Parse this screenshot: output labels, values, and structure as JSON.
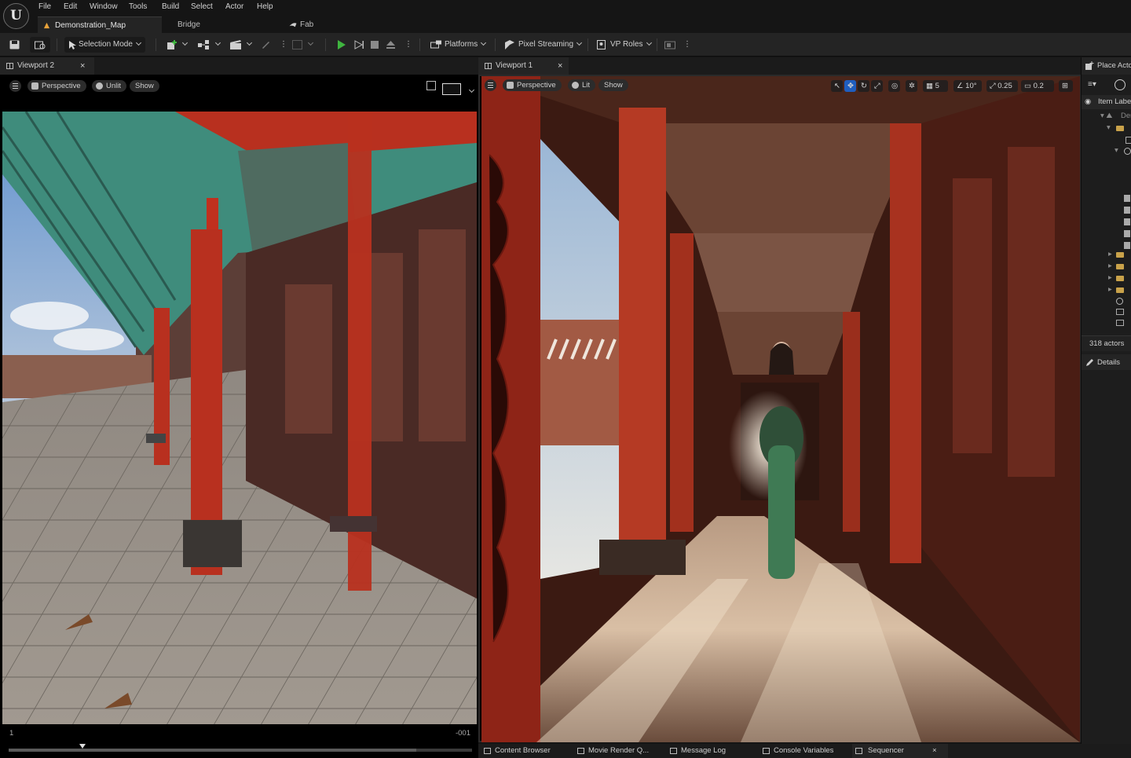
{
  "menu": [
    "File",
    "Edit",
    "Window",
    "Tools",
    "Build",
    "Select",
    "Actor",
    "Help"
  ],
  "doc_tabs": [
    "Demonstration_Map",
    "Bridge",
    "Fab"
  ],
  "toolbar": {
    "selection_mode": "Selection Mode",
    "platforms": "Platforms",
    "pixel_streaming": "Pixel Streaming",
    "vp_roles": "VP Roles"
  },
  "viewport2": {
    "tab": "Viewport 2",
    "close": "×",
    "perspective": "Perspective",
    "view_mode": "Unlit",
    "show": "Show",
    "timeline_start": "1",
    "timeline_end": "-001",
    "playhead_fraction": 0.16
  },
  "viewport1": {
    "tab": "Viewport 1",
    "close": "×",
    "perspective": "Perspective",
    "view_mode": "Lit",
    "show": "Show",
    "grid_snap": "5",
    "rotate_snap": "10°",
    "scale_snap": "0.25",
    "camera_speed": "0.2"
  },
  "outliner": {
    "place_actors": "Place Actors",
    "item_label": "Item Label",
    "row_partial": "Dem",
    "actor_count": "318 actors",
    "details": "Details"
  },
  "bottom_bar": {
    "content_browser": "Content Browser",
    "movie_render": "Movie Render Q...",
    "message_log": "Message Log",
    "console_variables": "Console Variables",
    "sequencer": "Sequencer",
    "close": "×"
  },
  "colors": {
    "accent_blue": "#1f5ebf",
    "play_green": "#3fb53f",
    "folder_yellow": "#c9a24a",
    "palace_red": "#b8301f",
    "roof_teal": "#3f8c7c"
  },
  "icons": [
    "unreal-logo-icon",
    "save-icon",
    "content-icon",
    "selection-mode-icon",
    "add-actor-icon",
    "blueprint-icon",
    "cinematics-icon",
    "build-icon",
    "play-icon",
    "step-icon",
    "stop-icon",
    "eject-icon",
    "platforms-icon",
    "pixel-streaming-icon",
    "vp-roles-icon",
    "grid-icon",
    "hamburger-icon",
    "filter-icon",
    "search-icon",
    "eye-icon",
    "folder-icon",
    "details-icon"
  ]
}
